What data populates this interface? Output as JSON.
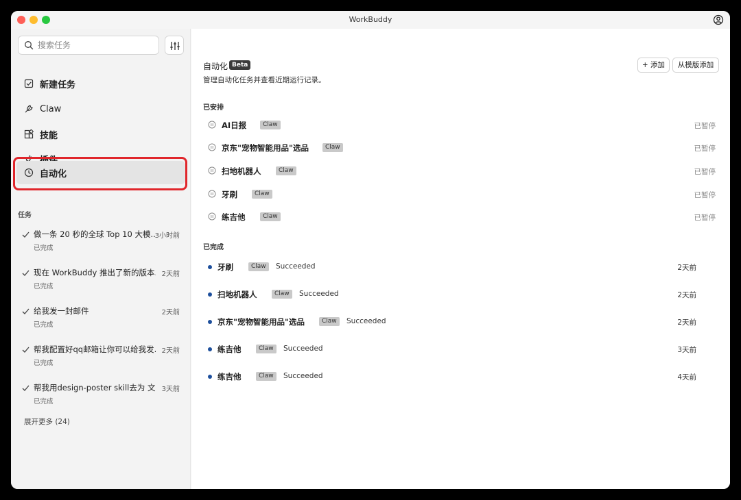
{
  "window": {
    "title": "WorkBuddy",
    "account_icon": "person-circle-icon"
  },
  "sidebar": {
    "search_placeholder": "搜索任务",
    "nav": [
      {
        "label": "新建任务",
        "icon": "new-task-icon"
      },
      {
        "label": "Claw",
        "icon": "claw-icon"
      },
      {
        "label": "技能",
        "icon": "skills-icon"
      },
      {
        "label": "插件",
        "icon": "plugin-icon"
      },
      {
        "label": "自动化",
        "icon": "clock-icon",
        "active": true
      }
    ],
    "tasks_label": "任务",
    "tasks": [
      {
        "title": "做一条 20 秒的全球 Top 10 大模...",
        "time": "3小时前",
        "status": "已完成"
      },
      {
        "title": "现在 WorkBuddy 推出了新的版本...",
        "time": "2天前",
        "status": "已完成"
      },
      {
        "title": "给我发一封邮件",
        "time": "2天前",
        "status": "已完成"
      },
      {
        "title": "帮我配置好qq邮箱让你可以给我发...",
        "time": "2天前",
        "status": "已完成"
      },
      {
        "title": "帮我用design-poster skill去为 文...",
        "time": "3天前",
        "status": "已完成"
      }
    ],
    "more_label": "展开更多 (24)"
  },
  "main": {
    "title": "自动化",
    "badge": "Beta",
    "subtitle": "管理自动化任务并查看近期运行记录。",
    "add_button": "+ 添加",
    "template_button": "从模版添加",
    "scheduled_label": "已安排",
    "scheduled": [
      {
        "name": "AI日报",
        "tag": "Claw",
        "state": "已暂停"
      },
      {
        "name": "京东\"宠物智能用品\"选品",
        "tag": "Claw",
        "state": "已暂停"
      },
      {
        "name": "扫地机器人",
        "tag": "Claw",
        "state": "已暂停"
      },
      {
        "name": "牙刷",
        "tag": "Claw",
        "state": "已暂停"
      },
      {
        "name": "练吉他",
        "tag": "Claw",
        "state": "已暂停"
      }
    ],
    "completed_label": "已完成",
    "completed": [
      {
        "name": "牙刷",
        "tag": "Claw",
        "result": "Succeeded",
        "ago": "2天前"
      },
      {
        "name": "扫地机器人",
        "tag": "Claw",
        "result": "Succeeded",
        "ago": "2天前"
      },
      {
        "name": "京东\"宠物智能用品\"选品",
        "tag": "Claw",
        "result": "Succeeded",
        "ago": "2天前"
      },
      {
        "name": "练吉他",
        "tag": "Claw",
        "result": "Succeeded",
        "ago": "3天前"
      },
      {
        "name": "练吉他",
        "tag": "Claw",
        "result": "Succeeded",
        "ago": "4天前"
      }
    ]
  },
  "colors": {
    "highlight": "#e0262b",
    "status_dot": "#1d4f9c",
    "tag_bg": "#c9c9c9"
  }
}
